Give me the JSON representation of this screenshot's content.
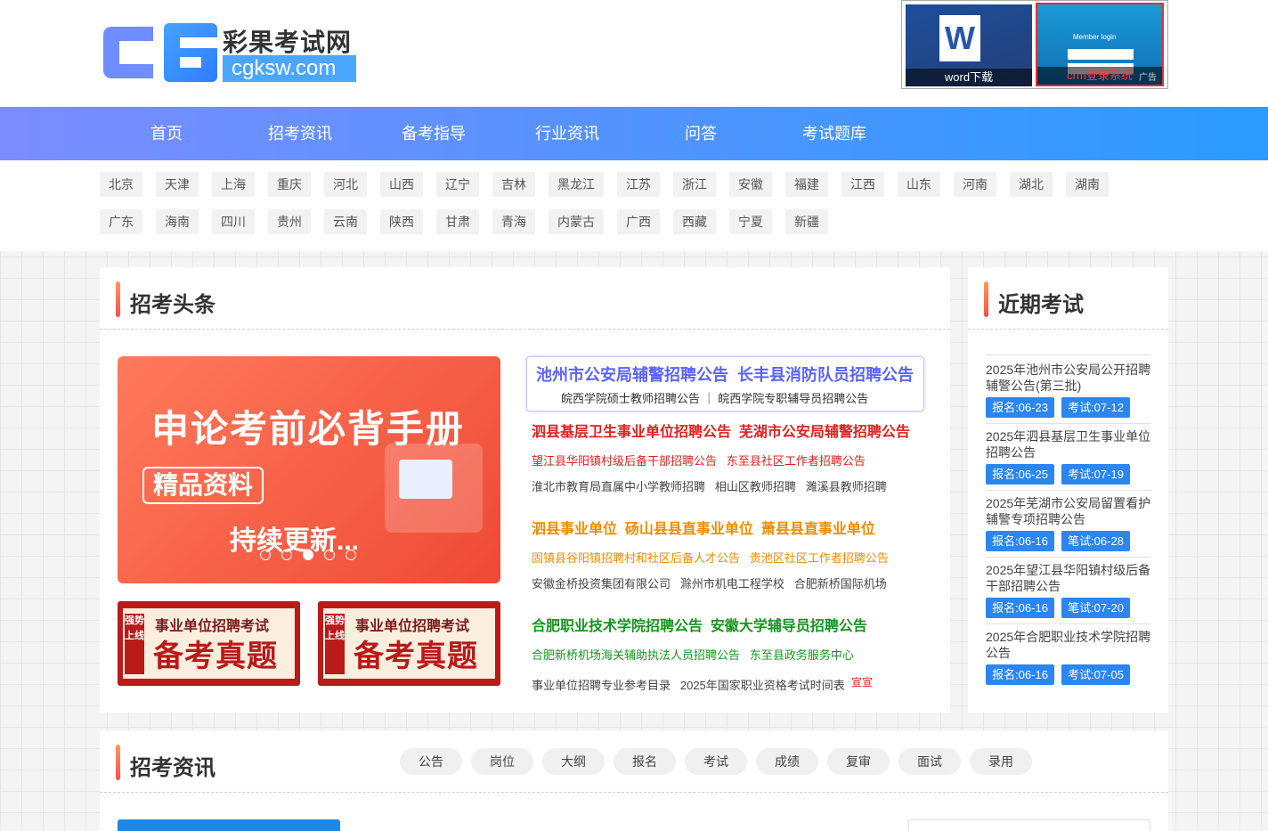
{
  "logo": {
    "name": "彩果考试网",
    "domain": "cgksw.com"
  },
  "ads": {
    "word_caption": "word下载",
    "crm_caption": "crm登录系统",
    "crm_member": "Member login",
    "ad_tag": "广告"
  },
  "nav": [
    "首页",
    "招考资讯",
    "备考指导",
    "行业资讯",
    "问答",
    "考试题库"
  ],
  "regions_row1": [
    "北京",
    "天津",
    "上海",
    "重庆",
    "河北",
    "山西",
    "辽宁",
    "吉林",
    "黑龙江",
    "江苏",
    "浙江",
    "安徽",
    "福建",
    "江西",
    "山东",
    "河南",
    "湖北",
    "湖南"
  ],
  "regions_row2": [
    "广东",
    "海南",
    "四川",
    "贵州",
    "云南",
    "陕西",
    "甘肃",
    "青海",
    "内蒙古",
    "广西",
    "西藏",
    "宁夏",
    "新疆"
  ],
  "headlines_section": {
    "title": "招考头条"
  },
  "banner": {
    "headline": "申论考前必背手册",
    "tag": "精品资料",
    "sub": "持续更新..."
  },
  "promo": {
    "side": "强势上线",
    "line1": "事业单位招聘考试",
    "line2": "备考真题"
  },
  "headline_box": {
    "a": "池州市公安局辅警招聘公告",
    "b": "长丰县消防队员招聘公告",
    "c": "皖西学院硕士教师招聘公告",
    "d": "皖西学院专职辅导员招聘公告"
  },
  "red_group": {
    "main1": "泗县基层卫生事业单位招聘公告",
    "main2": "芜湖市公安局辅警招聘公告",
    "sub1": "望江县华阳镇村级后备干部招聘公告",
    "sub2": "东至县社区工作者招聘公告",
    "g1": "淮北市教育局直属中小学教师招聘",
    "g2": "相山区教师招聘",
    "g3": "濉溪县教师招聘"
  },
  "orange_group": {
    "main1": "泗县事业单位",
    "main2": "砀山县县直事业单位",
    "main3": "萧县县直事业单位",
    "sub1": "固镇县谷阳镇招聘村和社区后备人才公告",
    "sub2": "贵池区社区工作者招聘公告",
    "g1": "安徽金桥投资集团有限公司",
    "g2": "滁州市机电工程学校",
    "g3": "合肥新桥国际机场"
  },
  "green_group": {
    "main1": "合肥职业技术学院招聘公告",
    "main2": "安徽大学辅导员招聘公告",
    "sub1": "合肥新桥机场海关辅助执法人员招聘公告",
    "sub2": "东至县政务服务中心",
    "g1": "事业单位招聘专业参考目录",
    "g2": "2025年国家职业资格考试时间表",
    "tag": "宣宣"
  },
  "recent": {
    "title": "近期考试",
    "items": [
      {
        "title": "2025年池州市公安局公开招聘辅警公告(第三批)",
        "reg": "报名:06-23",
        "exam": "考试:07-12"
      },
      {
        "title": "2025年泗县基层卫生事业单位招聘公告",
        "reg": "报名:06-25",
        "exam": "考试:07-19"
      },
      {
        "title": "2025年芜湖市公安局留置看护辅警专项招聘公告",
        "reg": "报名:06-16",
        "exam": "笔试:06-28"
      },
      {
        "title": "2025年望江县华阳镇村级后备干部招聘公告",
        "reg": "报名:06-16",
        "exam": "笔试:07-20"
      },
      {
        "title": "2025年合肥职业技术学院招聘公告",
        "reg": "报名:06-16",
        "exam": "考试:07-05"
      }
    ]
  },
  "news_section": {
    "title": "招考资讯",
    "cats": [
      "公告",
      "岗位",
      "大纲",
      "报名",
      "考试",
      "成绩",
      "复审",
      "面试",
      "录用"
    ]
  },
  "colors": {
    "nav_start": "#7b8cff",
    "nav_end": "#2a9bff",
    "pill": "#2b86f0",
    "red": "#e02020",
    "orange": "#f08c00",
    "green": "#16941e"
  }
}
